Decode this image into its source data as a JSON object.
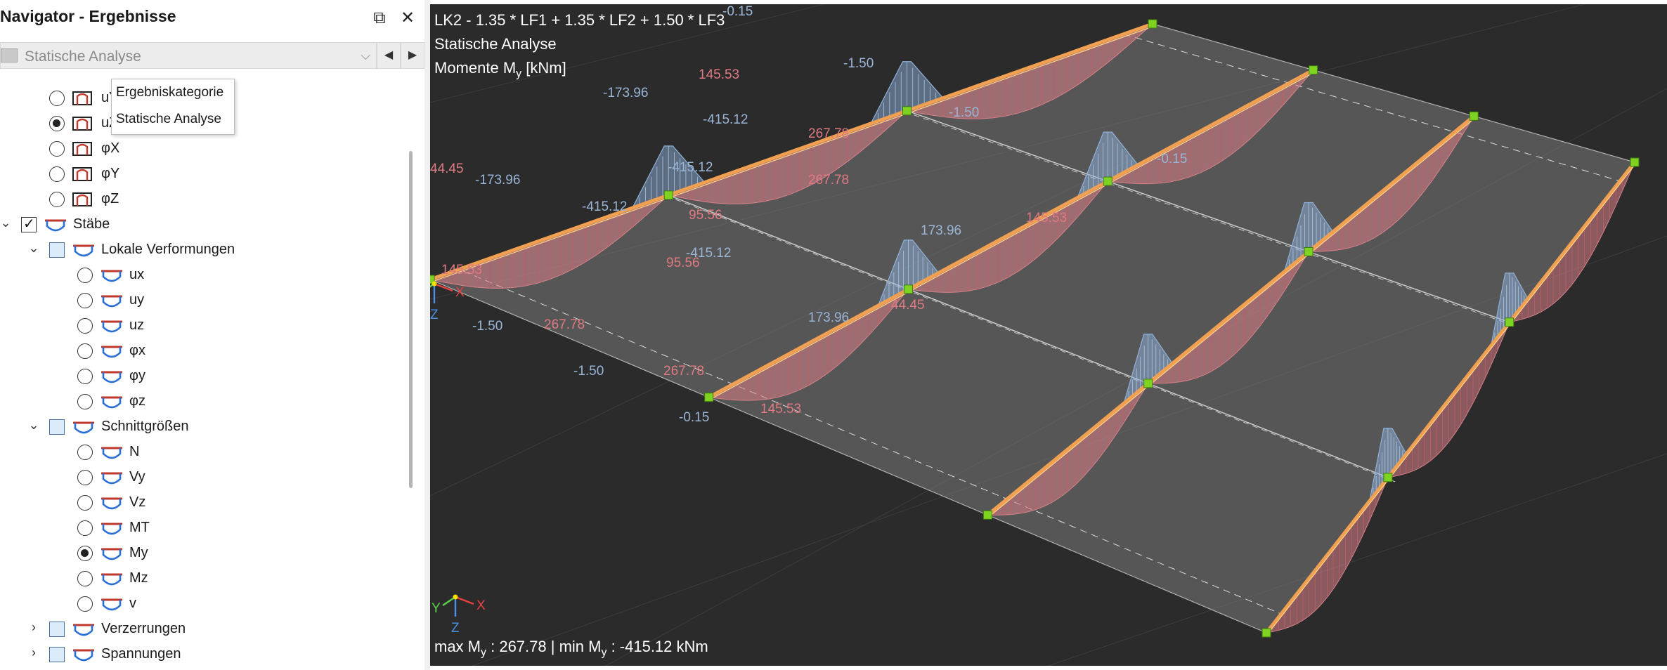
{
  "navigator": {
    "title": "Navigator - Ergebnisse",
    "restore_glyph": "⧉",
    "close_glyph": "✕",
    "combo": {
      "value": "Statische Analyse",
      "arrow": "⌵"
    },
    "prev_glyph": "◀",
    "next_glyph": "▶",
    "tooltip": {
      "line1": "Ergebniskategorie",
      "line2": "Statische Analyse"
    }
  },
  "tree": {
    "partial_top": [
      {
        "label": "uY",
        "selected": false
      },
      {
        "label": "uZ",
        "selected": true
      },
      {
        "label": "φX",
        "selected": false
      },
      {
        "label": "φY",
        "selected": false
      },
      {
        "label": "φZ",
        "selected": false
      }
    ],
    "staebe": {
      "label": "Stäbe",
      "expander": "⌄"
    },
    "lokale": {
      "label": "Lokale Verformungen",
      "expander": "⌄",
      "items": [
        {
          "label": "ux",
          "selected": false
        },
        {
          "label": "uy",
          "selected": false
        },
        {
          "label": "uz",
          "selected": false
        },
        {
          "label": "φx",
          "selected": false
        },
        {
          "label": "φy",
          "selected": false
        },
        {
          "label": "φz",
          "selected": false
        }
      ]
    },
    "schnitt": {
      "label": "Schnittgrößen",
      "expander": "⌄",
      "items": [
        {
          "label": "N",
          "selected": false
        },
        {
          "label": "Vy",
          "selected": false
        },
        {
          "label": "Vz",
          "selected": false
        },
        {
          "label": "MT",
          "selected": false
        },
        {
          "label": "My",
          "selected": true
        },
        {
          "label": "Mz",
          "selected": false
        },
        {
          "label": "v",
          "selected": false
        }
      ]
    },
    "verzerrungen": {
      "label": "Verzerrungen",
      "expander": "›"
    },
    "spannungen": {
      "label": "Spannungen",
      "expander": "›"
    }
  },
  "view": {
    "header_line1": "LK2 - 1.35 * LF1 + 1.35 * LF2 + 1.50 * LF3",
    "header_line2": "Statische Analyse",
    "header_line3_prefix": "Momente M",
    "header_line3_sub": "y",
    "header_line3_suffix": " [kNm]",
    "footer_max_prefix": "max M",
    "footer_max_sub": "y",
    "footer_max_value": " : 267.78 | min M",
    "footer_min_sub": "y",
    "footer_min_value": " : -415.12 kNm",
    "axis_labels": {
      "x": "X",
      "y": "Y",
      "z": "Z"
    },
    "colors": {
      "background": "#2b2b2b",
      "positive_moment": "#d9828a",
      "negative_moment": "#8fb2dc",
      "member": "#f0a050",
      "node": "#7ed321",
      "slab": "#7a7a7a"
    },
    "value_labels": [
      {
        "text": "-0.15",
        "kind": "neg"
      },
      {
        "text": "145.53",
        "kind": "pos"
      },
      {
        "text": "-1.50",
        "kind": "neg"
      },
      {
        "text": "-173.96",
        "kind": "neg"
      },
      {
        "text": "-415.12",
        "kind": "neg"
      },
      {
        "text": "267.78",
        "kind": "pos"
      },
      {
        "text": "-1.50",
        "kind": "neg"
      },
      {
        "text": "-415.12",
        "kind": "neg"
      },
      {
        "text": "267.78",
        "kind": "pos"
      },
      {
        "text": "-0.15",
        "kind": "neg"
      },
      {
        "text": "-173.96",
        "kind": "neg"
      },
      {
        "text": "44.45",
        "kind": "pos"
      },
      {
        "text": "-415.12",
        "kind": "neg"
      },
      {
        "text": "95.56",
        "kind": "pos"
      },
      {
        "text": "173.96",
        "kind": "neg"
      },
      {
        "text": "145.53",
        "kind": "pos"
      },
      {
        "text": "-415.12",
        "kind": "neg"
      },
      {
        "text": "95.56",
        "kind": "pos"
      },
      {
        "text": "-0.15",
        "kind": "neg"
      },
      {
        "text": "-1.50",
        "kind": "neg"
      },
      {
        "text": "267.78",
        "kind": "pos"
      },
      {
        "text": "145.53",
        "kind": "pos"
      },
      {
        "text": "173.96",
        "kind": "neg"
      },
      {
        "text": "44.45",
        "kind": "pos"
      },
      {
        "text": "-1.50",
        "kind": "neg"
      },
      {
        "text": "267.78",
        "kind": "pos"
      },
      {
        "text": "-0.15",
        "kind": "neg"
      },
      {
        "text": "145.53",
        "kind": "pos"
      }
    ]
  }
}
